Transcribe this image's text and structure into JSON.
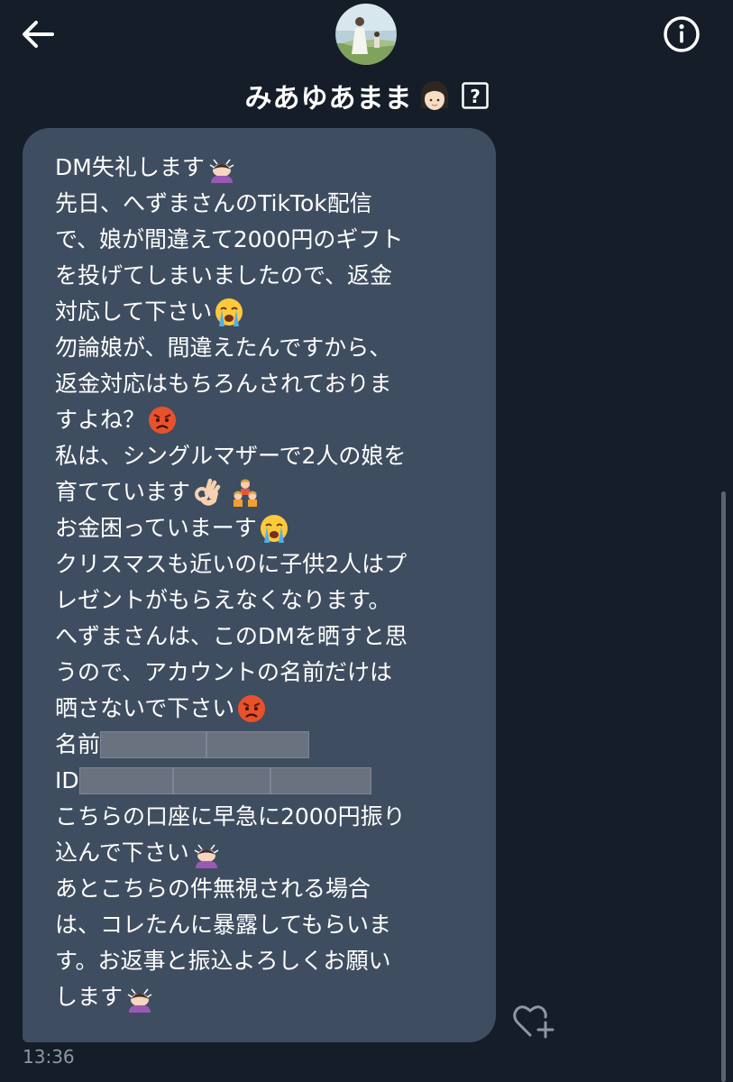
{
  "header": {
    "title": "みあゆあまま",
    "back_icon": "arrow-left-icon",
    "info_icon": "info-icon",
    "avatar_icon": "profile-photo",
    "title_emoji": "girl-face-emoji",
    "badge_icon": "question-box-icon",
    "badge_text": "?"
  },
  "message": {
    "lines": [
      "DM失礼します",
      "先日、へずまさんのTikTok配信",
      "で、娘が間違えて2000円のギフト",
      "を投げてしまいましたので、返金",
      "対応して下さい",
      "勿論娘が、間違えたんですから、",
      "返金対応はもちろんされておりま",
      "すよね？",
      "私は、シングルマザーで2人の娘を",
      "育てています",
      "お金困っていまーす",
      "クリスマスも近いのに子供2人はプ",
      "レゼントがもらえなくなります。",
      "へずまさんは、このDMを晒すと思",
      "うので、アカウントの名前だけは",
      "晒さないで下さい",
      "名前",
      "ID",
      "こちらの口座に早急に2000円振り",
      "込んで下さい",
      "あとこちらの件無視される場合",
      "は、コレたんに暴露してもらいま",
      "す。お返事と振込よろしくお願い",
      "します"
    ],
    "timestamp": "13:36"
  },
  "colors": {
    "background": "#151d28",
    "bubble": "#3f4d60",
    "text": "#ffffff",
    "timestamp": "#8b98a5",
    "redaction": "#6a7280"
  },
  "icons": {
    "bow": "person-bowing-emoji",
    "cry": "loudly-crying-face-emoji",
    "angry": "pouting-face-emoji",
    "ok": "ok-hand-emoji",
    "family": "family-emoji",
    "react": "heart-plus-icon"
  }
}
